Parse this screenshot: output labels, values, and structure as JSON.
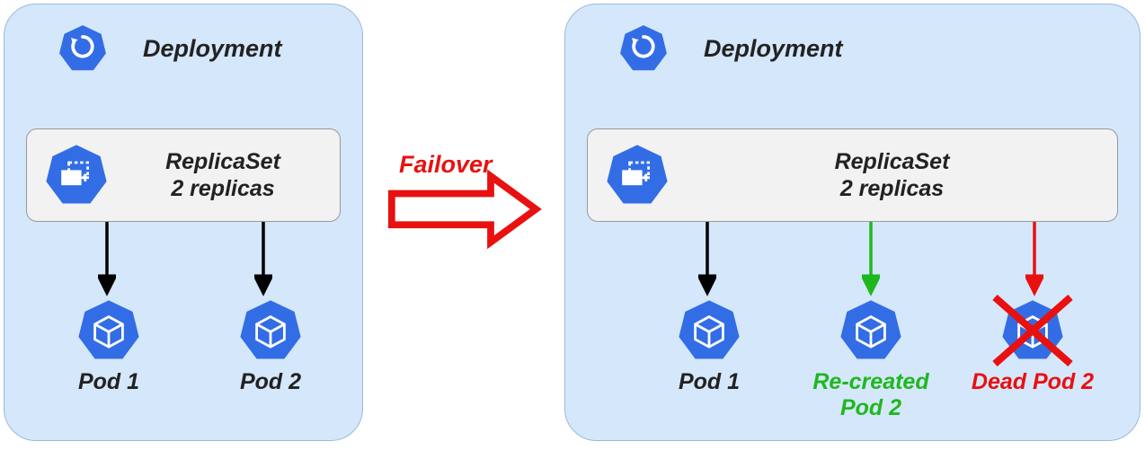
{
  "left": {
    "title": "Deployment",
    "rs_line1": "ReplicaSet",
    "rs_line2": "2 replicas",
    "pods": [
      {
        "label": "Pod 1"
      },
      {
        "label": "Pod 2"
      }
    ]
  },
  "right": {
    "title": "Deployment",
    "rs_line1": "ReplicaSet",
    "rs_line2": "2 replicas",
    "pods": [
      {
        "label": "Pod 1",
        "status": "normal"
      },
      {
        "label": "Re-created\nPod 2",
        "status": "recreated"
      },
      {
        "label": "Dead Pod 2",
        "status": "dead"
      }
    ]
  },
  "transition_label": "Failover",
  "colors": {
    "panel_bg": "#d5e7fb",
    "k8s_blue": "#326de6",
    "arrow_red": "#e91010",
    "arrow_green": "#1eb81e",
    "arrow_black": "#000000"
  }
}
